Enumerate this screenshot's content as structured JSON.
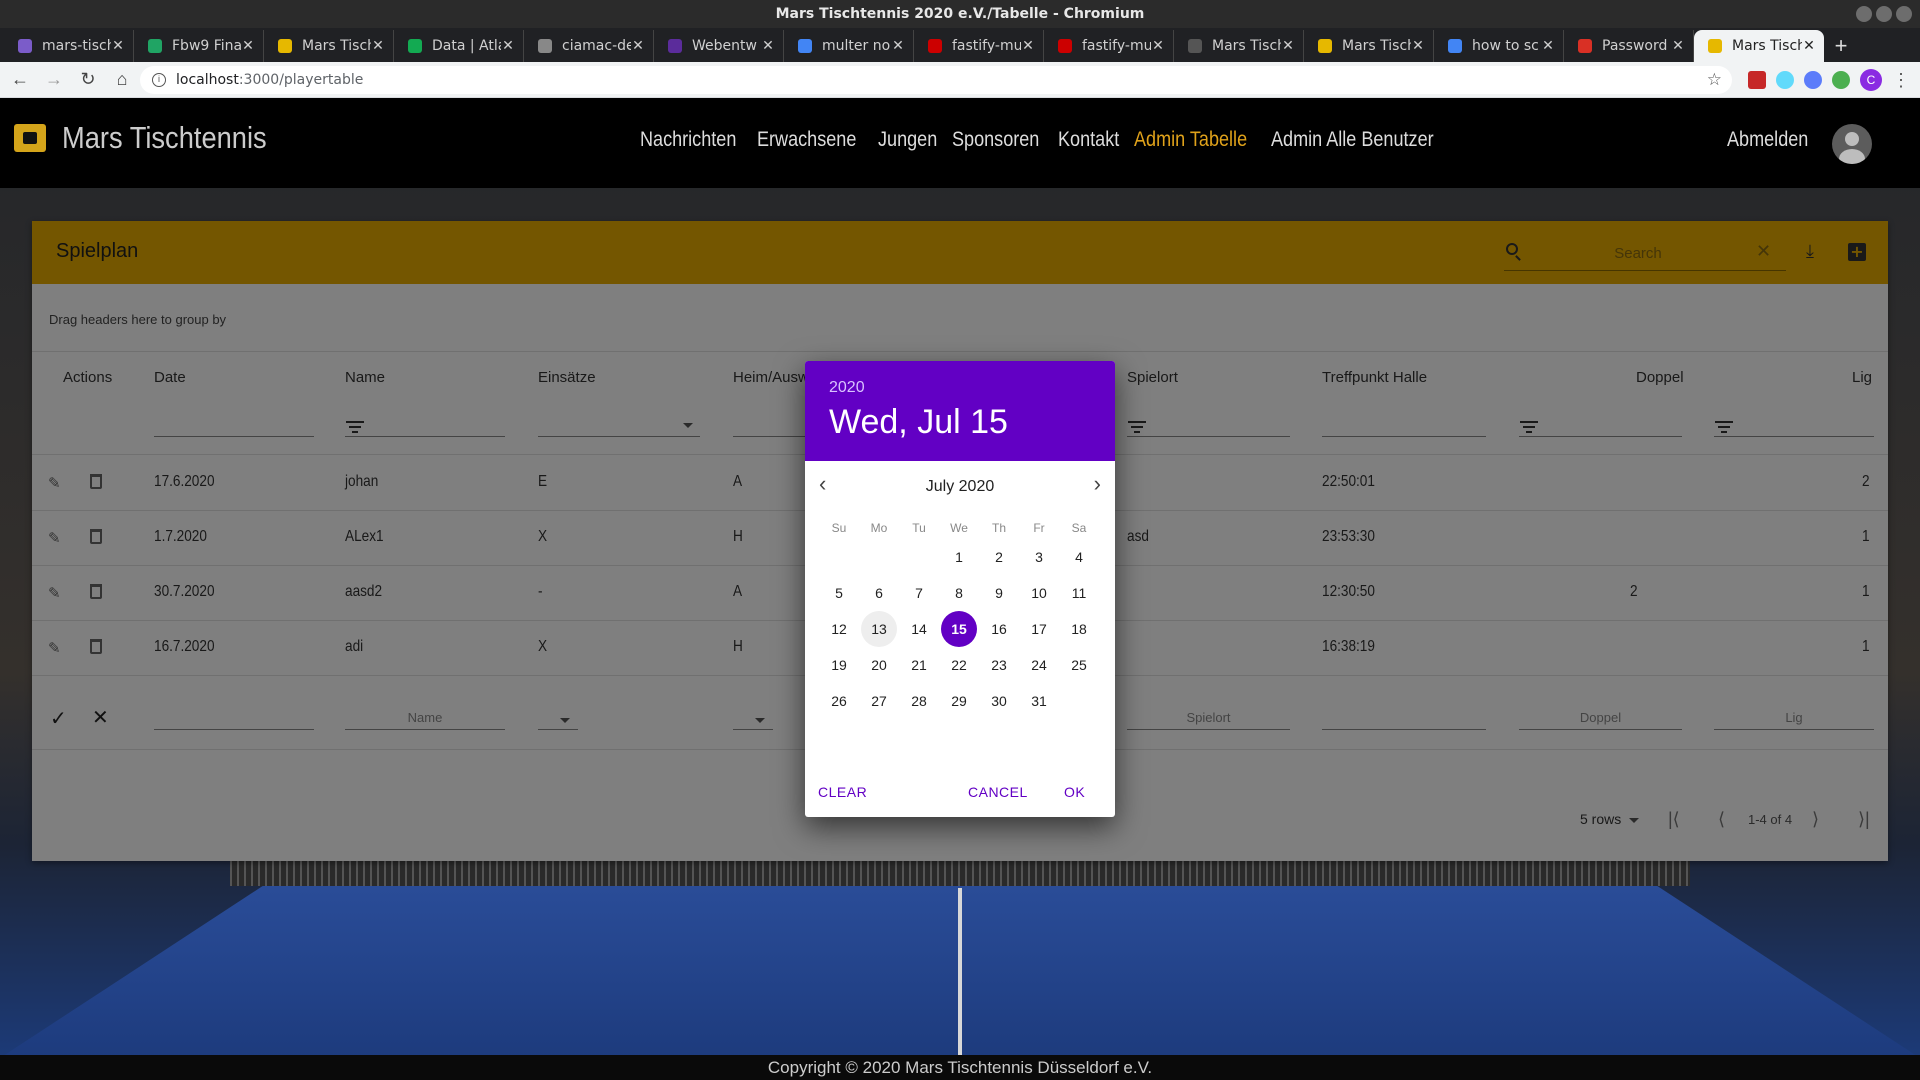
{
  "window": {
    "title": "Mars Tischtennis 2020 e.V./Tabelle - Chromium"
  },
  "tabs": [
    {
      "label": "mars-tisch",
      "color": "#7b5cc9"
    },
    {
      "label": "Fbw9 Fina",
      "color": "#20a464"
    },
    {
      "label": "Mars Tisch",
      "color": "#e6b800"
    },
    {
      "label": "Data | Atla",
      "color": "#13aa52"
    },
    {
      "label": "ciamac-de",
      "color": "#888888"
    },
    {
      "label": "Webentw",
      "color": "#5b2c9b"
    },
    {
      "label": "multer no",
      "color": "#4285f4"
    },
    {
      "label": "fastify-mu",
      "color": "#cc0000"
    },
    {
      "label": "fastify-mu",
      "color": "#cc0000"
    },
    {
      "label": "Mars Tisch",
      "color": "#555555"
    },
    {
      "label": "Mars Tisch",
      "color": "#e6b800"
    },
    {
      "label": "how to sc",
      "color": "#4285f4"
    },
    {
      "label": "Password",
      "color": "#d93025"
    },
    {
      "label": "Mars Tisch",
      "color": "#e6b800",
      "active": true
    }
  ],
  "address": {
    "host": "localhost",
    "path": ":3000/playertable"
  },
  "profile_initial": "C",
  "app": {
    "brand": "Mars Tischtennis",
    "nav": [
      "Nachrichten",
      "Erwachsene",
      "Jungen",
      "Sponsoren",
      "Kontakt",
      "Admin Tabelle",
      "Admin Alle Benutzer"
    ],
    "active_nav": "Admin Tabelle",
    "logout": "Abmelden",
    "accent": "#e0a21a"
  },
  "grid": {
    "title": "Spielplan",
    "search_placeholder": "Search",
    "group_hint": "Drag headers here to group by",
    "columns": [
      "Actions",
      "Date",
      "Name",
      "Einsätze",
      "Heim/Ausw",
      "Spielort",
      "Treffpunkt Halle",
      "Doppel",
      "Lig"
    ],
    "rows": [
      {
        "date": "17.6.2020",
        "name": "johan",
        "einsaetze": "E",
        "heim": "A",
        "spielort": "",
        "treffpunkt": "22:50:01",
        "doppel": "",
        "liga": "2"
      },
      {
        "date": "1.7.2020",
        "name": "ALex1",
        "einsaetze": "X",
        "heim": "H",
        "spielort": "asd",
        "treffpunkt": "23:53:30",
        "doppel": "",
        "liga": "1"
      },
      {
        "date": "30.7.2020",
        "name": "aasd2",
        "einsaetze": "-",
        "heim": "A",
        "spielort": "",
        "treffpunkt": "12:30:50",
        "doppel": "2",
        "liga": "1"
      },
      {
        "date": "16.7.2020",
        "name": "adi",
        "einsaetze": "X",
        "heim": "H",
        "spielort": "",
        "treffpunkt": "16:38:19",
        "doppel": "",
        "liga": "1"
      }
    ],
    "add_row_placeholders": {
      "name": "Name",
      "spielort": "Spielort",
      "doppel": "Doppel",
      "liga": "Lig"
    },
    "pager": {
      "rows": "5 rows",
      "range": "1-4 of 4"
    }
  },
  "picker": {
    "year": "2020",
    "date_label": "Wed, Jul 15",
    "month_label": "July 2020",
    "weekdays": [
      "Su",
      "Mo",
      "Tu",
      "We",
      "Th",
      "Fr",
      "Sa"
    ],
    "first_weekday": 3,
    "days_in_month": 31,
    "today": 13,
    "selected": 15,
    "clear": "CLEAR",
    "cancel": "CANCEL",
    "ok": "OK",
    "accent": "#6200c4"
  },
  "footer": "Copyright © 2020  Mars Tischtennis Düsseldorf e.V."
}
